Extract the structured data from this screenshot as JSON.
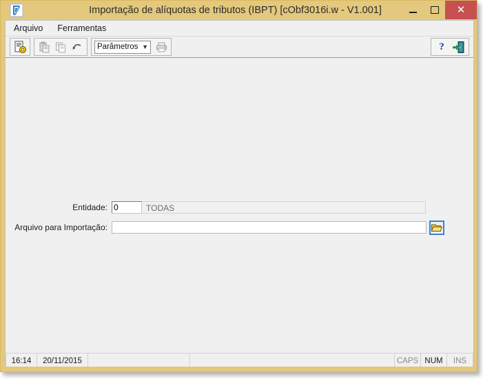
{
  "window": {
    "title": "Importação de alíquotas de tributos (IBPT) [cObf3016i.w - V1.001]",
    "app_icon": "app-icon",
    "frame_color": "#e3c87d",
    "client_color": "#f0f0f0",
    "controls": {
      "minimize": "minimize-icon",
      "maximize": "maximize-icon",
      "close": "close-icon",
      "close_label": "✕",
      "close_color": "#c75050"
    }
  },
  "menubar": {
    "items": [
      {
        "label": "Arquivo",
        "name": "menu-item-arquivo"
      },
      {
        "label": "Ferramentas",
        "name": "menu-item-ferramentas"
      }
    ]
  },
  "toolbar": {
    "buttons": [
      {
        "name": "execute-button",
        "icon": "document-gear-icon",
        "enabled": true
      },
      {
        "name": "paste-button",
        "icon": "paste-icon",
        "enabled": false
      },
      {
        "name": "copy-button",
        "icon": "copy-icon",
        "enabled": false
      },
      {
        "name": "undo-button",
        "icon": "undo-icon",
        "enabled": false
      },
      {
        "name": "print-button",
        "icon": "printer-icon",
        "enabled": false
      }
    ],
    "combo": {
      "name": "parametros-combo",
      "value": "Parâmetros",
      "chevron": "▼"
    },
    "help": {
      "name": "help-button",
      "label": "?",
      "color": "#0e3fa8"
    },
    "exit": {
      "name": "exit-button",
      "icon": "exit-door-icon"
    }
  },
  "form": {
    "entidade": {
      "label": "Entidade:",
      "value": "0",
      "placeholder": "",
      "description": "TODAS"
    },
    "arquivo": {
      "label": "Arquivo para Importação:",
      "value": "",
      "placeholder": "",
      "browse": {
        "name": "browse-folder-button",
        "icon": "open-folder-icon"
      }
    }
  },
  "statusbar": {
    "time": "16:14",
    "date": "20/11/2015",
    "panel1": "",
    "panel2": "",
    "indicators": [
      {
        "label": "CAPS",
        "active": false,
        "name": "status-caps"
      },
      {
        "label": "NUM",
        "active": true,
        "name": "status-num"
      },
      {
        "label": "INS",
        "active": false,
        "name": "status-ins"
      }
    ]
  }
}
